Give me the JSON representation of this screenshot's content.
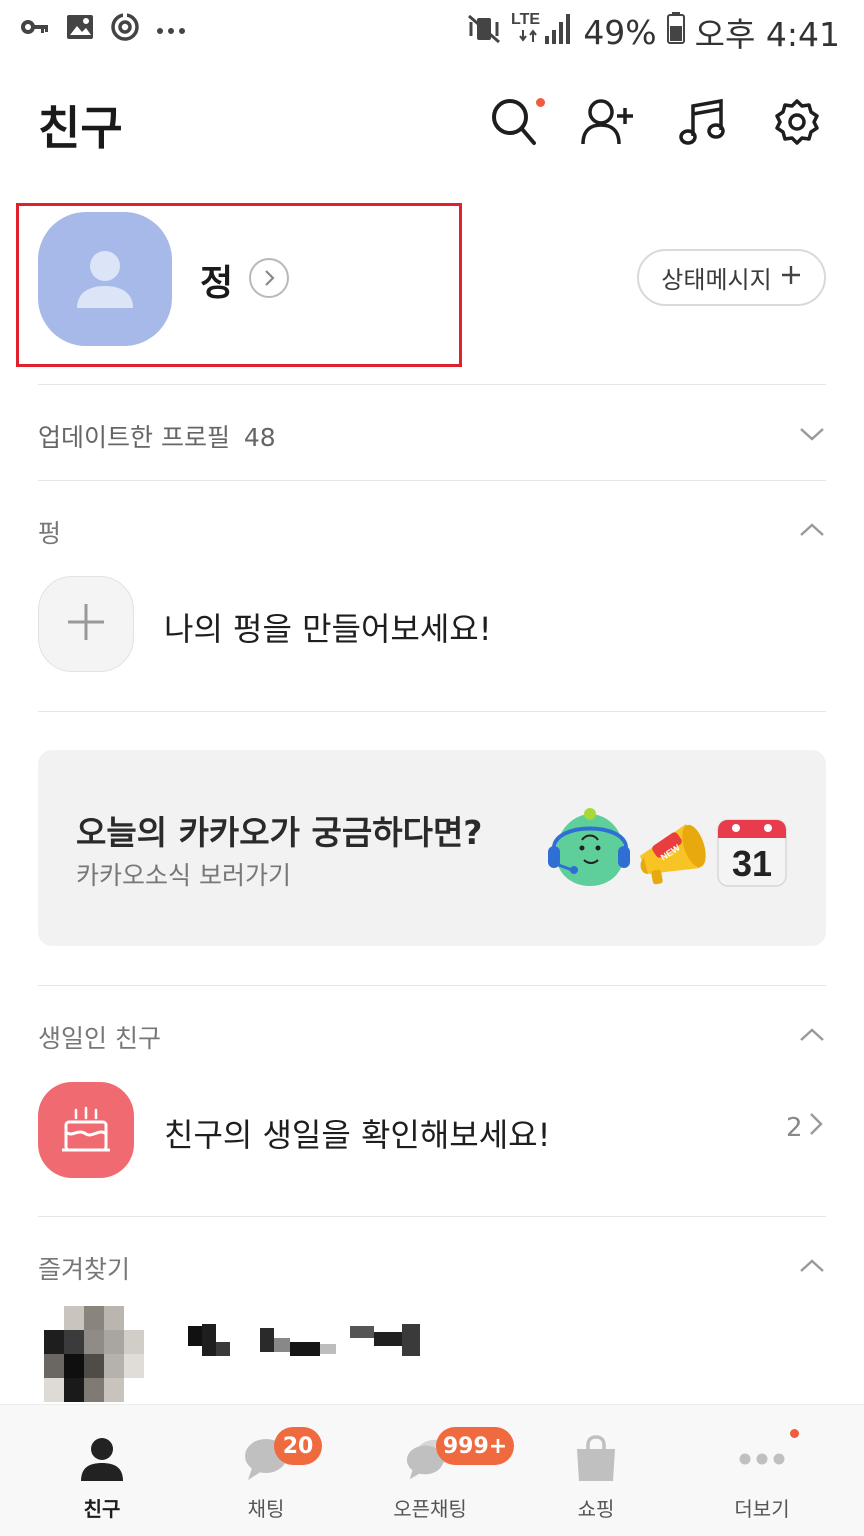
{
  "status_bar": {
    "left_icons": [
      "key-icon",
      "image-icon",
      "sync-icon",
      "more-dots-icon"
    ],
    "right_icons": [
      "vibrate-mute-icon",
      "lte-signal-icon",
      "battery-icon"
    ],
    "network": "LTE",
    "battery": "49%",
    "time": "오후 4:41"
  },
  "header": {
    "title": "친구",
    "icons": [
      "search-icon",
      "add-friend-icon",
      "music-icon",
      "settings-icon"
    ],
    "accent_dot_color": "#f15b3e"
  },
  "profile": {
    "name": "정",
    "status_message_label": "상태메시지",
    "avatar_color": "#a6b9e8"
  },
  "sections": {
    "updated_profiles": {
      "label": "업데이트한 프로필",
      "count": "48"
    },
    "pung": {
      "label": "펑",
      "create_text": "나의 펑을 만들어보세요!"
    },
    "banner": {
      "title": "오늘의 카카오가 궁금하다면?",
      "subtitle": "카카오소식 보러가기",
      "calendar_day": "31",
      "megaphone_tag": "NEW"
    },
    "birthday": {
      "label": "생일인 친구",
      "text": "친구의 생일을 확인해보세요!",
      "count": "2",
      "icon_color": "#ef6b71"
    },
    "favorites": {
      "label": "즐겨찾기"
    }
  },
  "bottom_nav": {
    "items": [
      {
        "label": "친구",
        "icon": "person-icon",
        "active": true
      },
      {
        "label": "채팅",
        "icon": "chat-bubble-icon",
        "badge": "20"
      },
      {
        "label": "오픈채팅",
        "icon": "open-chat-icon",
        "badge": "999+"
      },
      {
        "label": "쇼핑",
        "icon": "shopping-bag-icon"
      },
      {
        "label": "더보기",
        "icon": "more-dots-icon"
      }
    ],
    "badge_color": "#f06a3f"
  }
}
